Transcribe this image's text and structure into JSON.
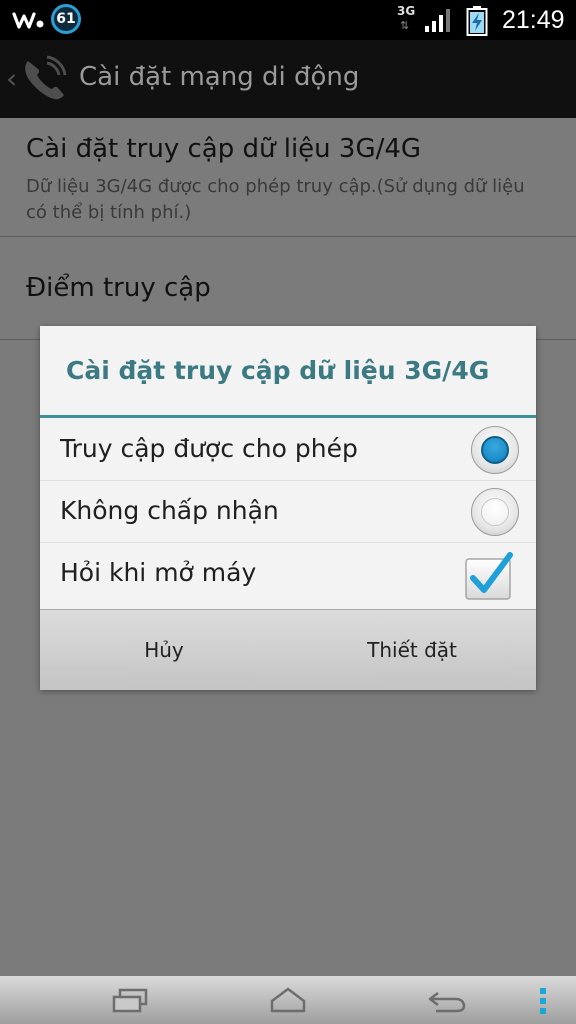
{
  "status_bar": {
    "notification_count": "61",
    "network_type": "3G",
    "network_arrows": "⇅",
    "time": "21:49",
    "icons": [
      "walkman-icon",
      "signal-icon",
      "battery-charging-icon"
    ]
  },
  "action_bar": {
    "title": "Cài đặt mạng di động",
    "icon": "phone-icon"
  },
  "settings": {
    "items": [
      {
        "title": "Cài đặt truy cập dữ liệu 3G/4G",
        "summary": "Dữ liệu 3G/4G được cho phép truy cập.(Sử dụng dữ liệu có thể bị tính phí.)"
      },
      {
        "title": "Điểm truy cập"
      }
    ]
  },
  "dialog": {
    "title": "Cài đặt truy cập dữ liệu 3G/4G",
    "options": [
      {
        "label": "Truy cập được cho phép",
        "control": "radio",
        "selected": true
      },
      {
        "label": "Không chấp nhận",
        "control": "radio",
        "selected": false
      },
      {
        "label": "Hỏi khi mở máy",
        "control": "checkbox",
        "checked": true
      }
    ],
    "buttons": {
      "cancel": "Hủy",
      "ok": "Thiết đặt"
    }
  },
  "colors": {
    "accent": "#3e8f98",
    "dialog_title": "#3b7a82",
    "radio_selected": "#1b8cc8",
    "check": "#1fa0d8"
  },
  "nav_bar": {
    "icons": [
      "recent-apps-icon",
      "home-icon",
      "back-icon",
      "menu-icon"
    ]
  }
}
